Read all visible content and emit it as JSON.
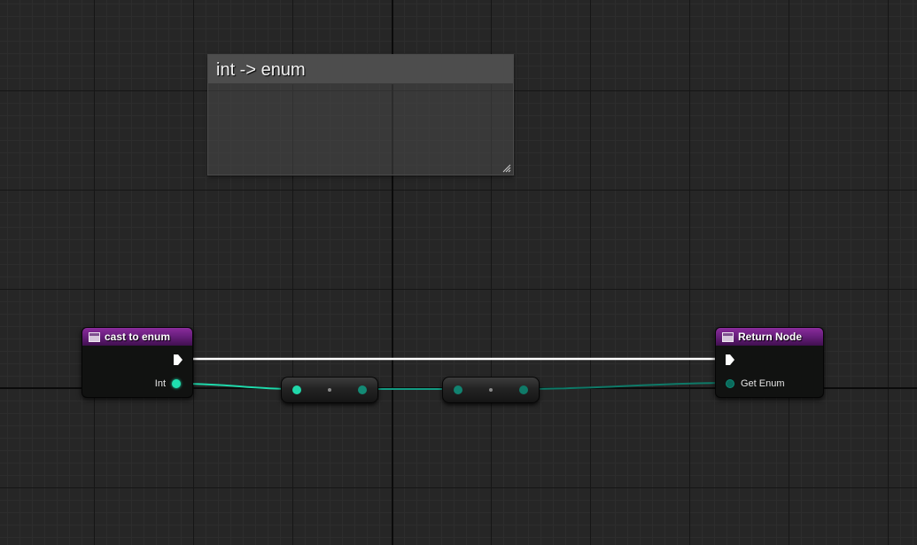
{
  "comment": {
    "title": "int -> enum"
  },
  "nodes": {
    "cast_to_enum": {
      "title": "cast to enum",
      "output_pin_label": "Int"
    },
    "return_node": {
      "title": "Return Node",
      "input_pin_label": "Get Enum"
    }
  },
  "colors": {
    "function_header": "#6a1f7e",
    "exec_wire": "#ffffff",
    "int_pin": "#1fe0b0",
    "enum_pin": "#0a6a5c",
    "grid_background": "#262626"
  },
  "icons": {
    "function": "function-icon",
    "exec": "exec-pin-icon",
    "resize": "resize-handle-icon"
  }
}
